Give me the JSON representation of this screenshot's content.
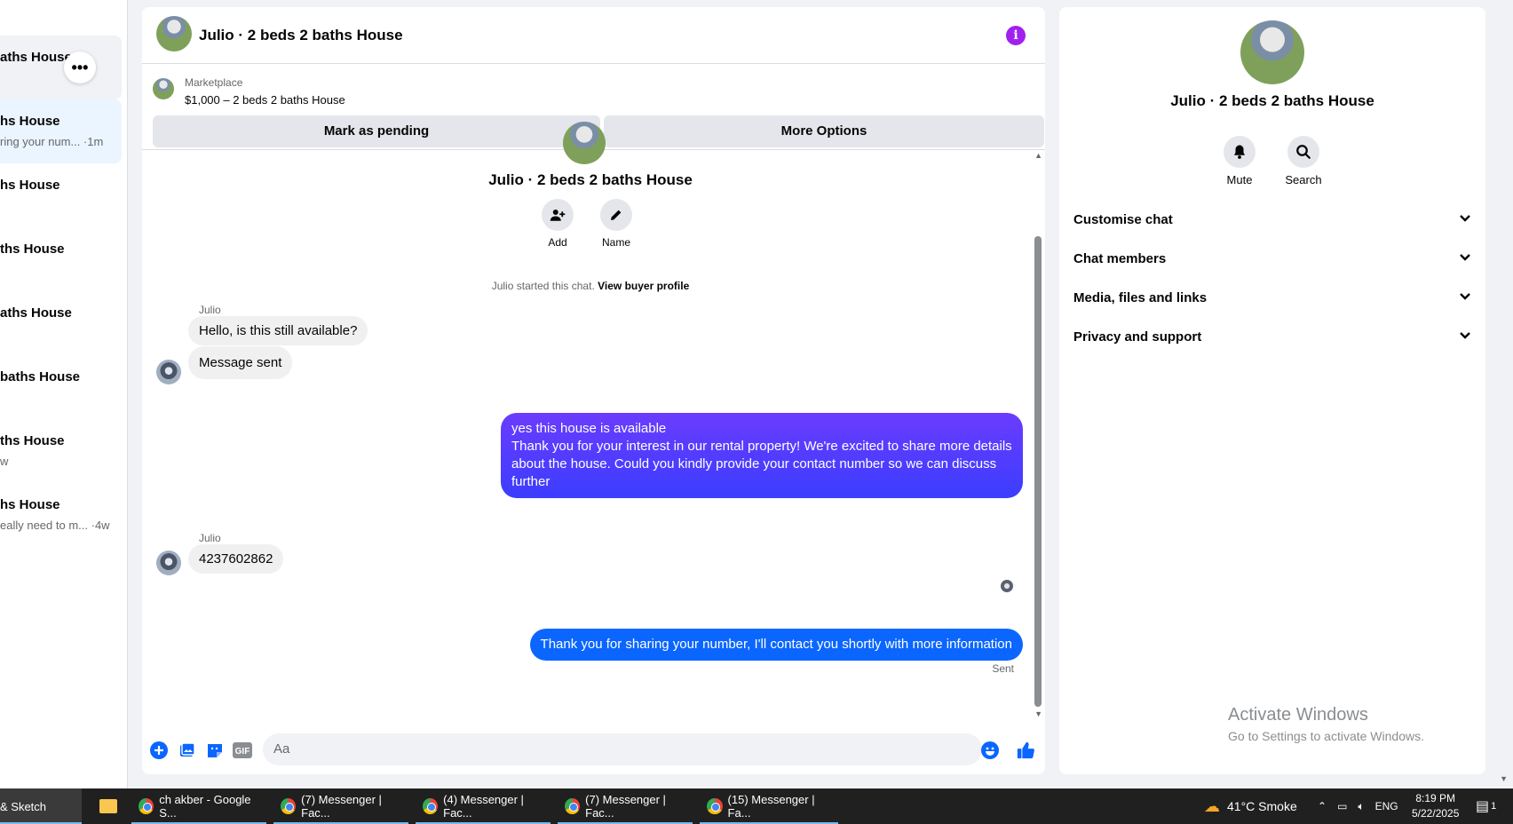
{
  "sidebar": {
    "conversations": [
      {
        "title": "aths House",
        "snippet": ""
      },
      {
        "title": "hs House",
        "snippet": "ring your num... ·1m"
      },
      {
        "title": "hs House",
        "snippet": ""
      },
      {
        "title": "ths House",
        "snippet": ""
      },
      {
        "title": "aths House",
        "snippet": ""
      },
      {
        "title": "baths House",
        "snippet": ""
      },
      {
        "title": "ths House",
        "snippet": "w"
      },
      {
        "title": "hs House",
        "snippet": "eally need to m... ·4w"
      }
    ],
    "more_label": "•••"
  },
  "chat": {
    "title": "Julio · 2 beds 2 baths House",
    "info_icon": "i",
    "marketplace": {
      "label": "Marketplace",
      "listing": "$1,000 – 2 beds 2 baths House",
      "pending_button": "Mark as pending",
      "more_button": "More Options"
    },
    "intro": {
      "title": "Julio · 2 beds 2 baths House",
      "add_label": "Add",
      "name_label": "Name",
      "started_text": "Julio started this chat.",
      "buyer_profile_link": "View buyer profile"
    },
    "messages": {
      "sender_1": "Julio",
      "incoming_1": "Hello, is this still available?",
      "incoming_2": "Message sent",
      "outgoing_1_line1": "yes this house is available",
      "outgoing_1_line2": "Thank you for your interest in our rental property! We're excited to share more details about the house. Could you kindly provide your contact number so we can discuss further",
      "sender_2": "Julio",
      "incoming_3": "4237602862",
      "outgoing_2": "Thank you for sharing your number, I'll contact you shortly with more information",
      "status": "Sent"
    },
    "composer": {
      "placeholder": "Aa",
      "gif_label": "GIF"
    }
  },
  "info_panel": {
    "title": "Julio · 2 beds 2 baths House",
    "mute_label": "Mute",
    "search_label": "Search",
    "sections": [
      "Customise chat",
      "Chat members",
      "Media, files and links",
      "Privacy and support"
    ]
  },
  "watermark": {
    "line1": "Activate Windows",
    "line2": "Go to Settings to activate Windows."
  },
  "taskbar": {
    "items": [
      "& Sketch",
      "ch akber - Google S...",
      "(7) Messenger | Fac...",
      "(4) Messenger | Fac...",
      "(7) Messenger | Fac...",
      "(15) Messenger | Fa..."
    ],
    "weather": "41°C  Smoke",
    "language": "ENG",
    "time": "8:19 PM",
    "date": "5/22/2025",
    "notification_count": "1"
  },
  "colors": {
    "accent_blue": "#0a66ff",
    "gradient_purple": "#6b3cff",
    "info_purple": "#a020f0"
  }
}
